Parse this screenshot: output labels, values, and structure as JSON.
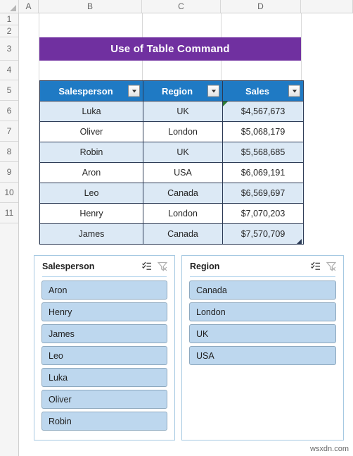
{
  "sheet": {
    "column_headers": [
      "A",
      "B",
      "C",
      "D"
    ],
    "row_headers": [
      "1",
      "2",
      "3",
      "4",
      "5",
      "6",
      "7",
      "8",
      "9",
      "10",
      "11"
    ]
  },
  "title_banner": {
    "text": "Use of Table Command",
    "background_color": "#7030A0",
    "text_color": "#FFFFFF"
  },
  "table": {
    "header_background": "#1F7AC4",
    "band_color": "#DCE9F5",
    "columns": [
      "Salesperson",
      "Region",
      "Sales"
    ],
    "rows": [
      {
        "salesperson": "Luka",
        "region": "UK",
        "sales": "$4,567,673"
      },
      {
        "salesperson": "Oliver",
        "region": "London",
        "sales": "$5,068,179"
      },
      {
        "salesperson": "Robin",
        "region": "UK",
        "sales": "$5,568,685"
      },
      {
        "salesperson": "Aron",
        "region": "USA",
        "sales": "$6,069,191"
      },
      {
        "salesperson": "Leo",
        "region": "Canada",
        "sales": "$6,569,697"
      },
      {
        "salesperson": "Henry",
        "region": "London",
        "sales": "$7,070,203"
      },
      {
        "salesperson": "James",
        "region": "Canada",
        "sales": "$7,570,709"
      }
    ]
  },
  "slicers": [
    {
      "title": "Salesperson",
      "multiselect_icon": "multi-select-icon",
      "clear_filter_icon": "clear-filter-icon",
      "item_color": "#BDD7EE",
      "items": [
        "Aron",
        "Henry",
        "James",
        "Leo",
        "Luka",
        "Oliver",
        "Robin"
      ]
    },
    {
      "title": "Region",
      "multiselect_icon": "multi-select-icon",
      "clear_filter_icon": "clear-filter-icon",
      "item_color": "#BDD7EE",
      "items": [
        "Canada",
        "London",
        "UK",
        "USA"
      ]
    }
  ],
  "watermark": {
    "text": "wsxdn.com"
  }
}
